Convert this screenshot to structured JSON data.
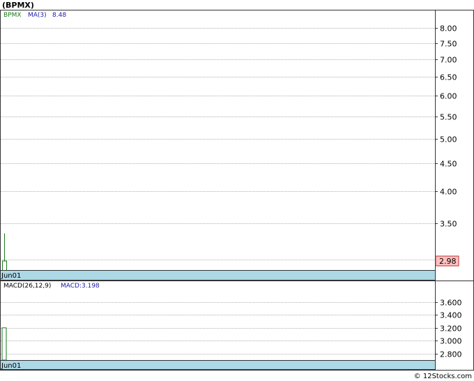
{
  "title": "(BPMX)",
  "watermark": "© 12Stocks.com",
  "colors": {
    "axis_strip": "#add8e6",
    "candle": "#1a7a1a",
    "ticker_label": "#1a7a1a",
    "ma_label": "#1a1aa8",
    "price_badge_bg": "#ffc0c0",
    "price_badge_border": "#c03030",
    "grid": "#b0b0b0"
  },
  "price_panel": {
    "ticker": "BPMX",
    "ma_label": "MA(3)",
    "ma_value": "8.48",
    "date_label": "Jun01",
    "last_price_badge": "2.98",
    "y_ticks": [
      "8.00",
      "7.50",
      "7.00",
      "6.50",
      "6.00",
      "5.50",
      "5.00",
      "4.50",
      "4.00",
      "3.50",
      "3.00"
    ]
  },
  "macd_panel": {
    "label": "MACD(26,12,9)",
    "value_label": "MACD:3.198",
    "date_label": "Jun01",
    "y_ticks": [
      "3.600",
      "3.400",
      "3.200",
      "3.000",
      "2.800"
    ]
  },
  "chart_data": [
    {
      "type": "candlestick",
      "scale": "log",
      "ylim": [
        2.98,
        8.48
      ],
      "x": [
        "Jun01"
      ],
      "open": [
        2.6
      ],
      "high": [
        3.35
      ],
      "low": [
        2.45
      ],
      "close": [
        2.98
      ],
      "series": [
        {
          "name": "MA(3)",
          "values": [
            8.48
          ]
        }
      ]
    },
    {
      "type": "bar",
      "ylim": [
        2.7,
        3.8
      ],
      "x": [
        "Jun01"
      ],
      "series": [
        {
          "name": "MACD",
          "values": [
            3.198
          ]
        }
      ]
    }
  ]
}
